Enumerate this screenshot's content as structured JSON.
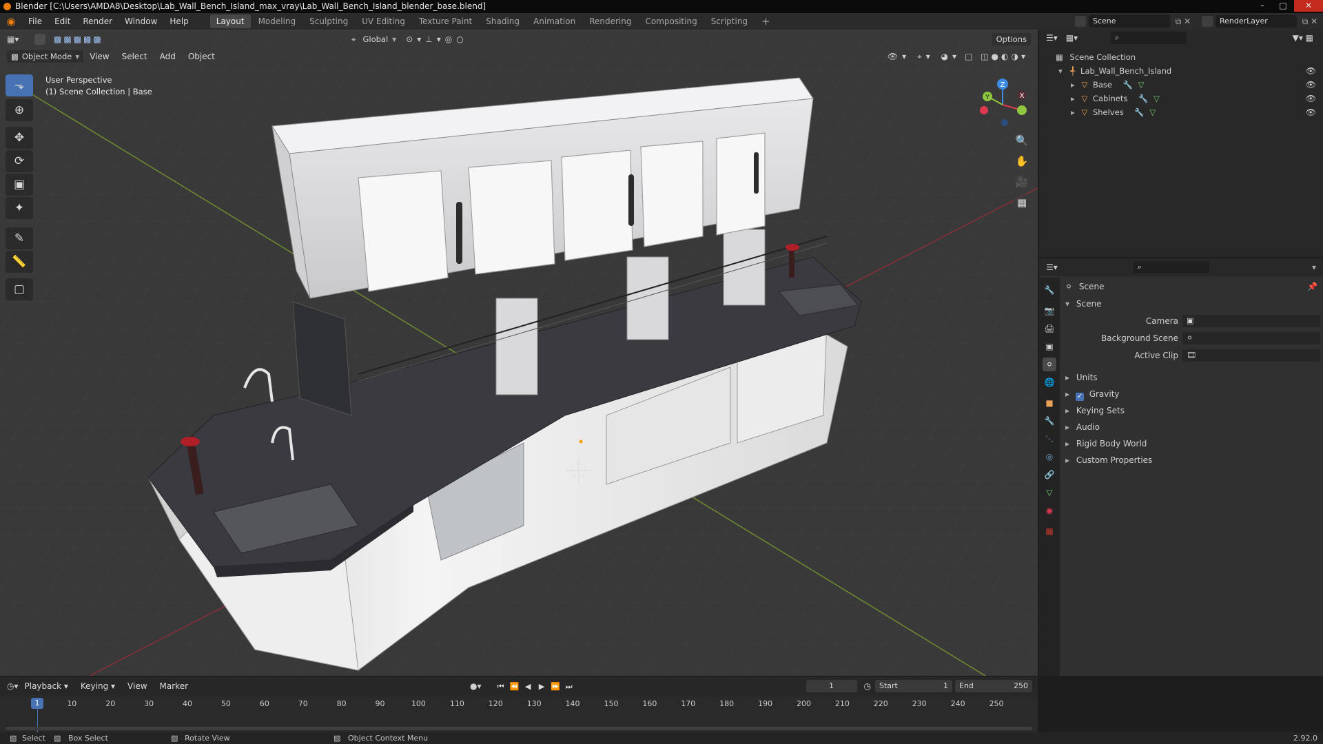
{
  "window": {
    "title": "Blender [C:\\Users\\AMDA8\\Desktop\\Lab_Wall_Bench_Island_max_vray\\Lab_Wall_Bench_Island_blender_base.blend]"
  },
  "menu": {
    "items": [
      "File",
      "Edit",
      "Render",
      "Window",
      "Help"
    ]
  },
  "workspaces": [
    "Layout",
    "Modeling",
    "Sculpting",
    "UV Editing",
    "Texture Paint",
    "Shading",
    "Animation",
    "Rendering",
    "Compositing",
    "Scripting"
  ],
  "active_workspace": "Layout",
  "scene_selector": {
    "value": "Scene"
  },
  "renderlayer_selector": {
    "value": "RenderLayer"
  },
  "viewport": {
    "transform_orientation": "Global",
    "options_label": "Options",
    "mode": "Object Mode",
    "menus": [
      "View",
      "Select",
      "Add",
      "Object"
    ],
    "overlay_line1": "User Perspective",
    "overlay_line2": "(1) Scene Collection | Base",
    "gizmo_axes": [
      "Z",
      "Y",
      "X"
    ]
  },
  "outliner": {
    "root": "Scene Collection",
    "collection": "Lab_Wall_Bench_Island",
    "objects": [
      "Base",
      "Cabinets",
      "Shelves"
    ]
  },
  "properties": {
    "context_title": "Scene",
    "panel_scene": "Scene",
    "fields": [
      {
        "label": "Camera",
        "value": ""
      },
      {
        "label": "Background Scene",
        "value": ""
      },
      {
        "label": "Active Clip",
        "value": ""
      }
    ],
    "subpanels": [
      "Units",
      "Gravity",
      "Keying Sets",
      "Audio",
      "Rigid Body World",
      "Custom Properties"
    ],
    "gravity_checked": true
  },
  "timeline": {
    "menus": [
      "Playback",
      "Keying",
      "View",
      "Marker"
    ],
    "current_frame": "1",
    "start_label": "Start",
    "start": "1",
    "end_label": "End",
    "end": "250",
    "ticks": [
      "1",
      "10",
      "20",
      "30",
      "40",
      "50",
      "60",
      "70",
      "80",
      "90",
      "100",
      "110",
      "120",
      "130",
      "140",
      "150",
      "160",
      "170",
      "180",
      "190",
      "200",
      "210",
      "220",
      "230",
      "240",
      "250"
    ]
  },
  "status": {
    "select": "Select",
    "box_select": "Box Select",
    "rotate_view": "Rotate View",
    "context_menu": "Object Context Menu",
    "version": "2.92.0"
  },
  "colors": {
    "accent": "#4772b3",
    "brand": "#e87d0d",
    "x_axis": "#e0394f",
    "y_axis": "#8ec63f",
    "z_axis": "#3c8ce6"
  }
}
